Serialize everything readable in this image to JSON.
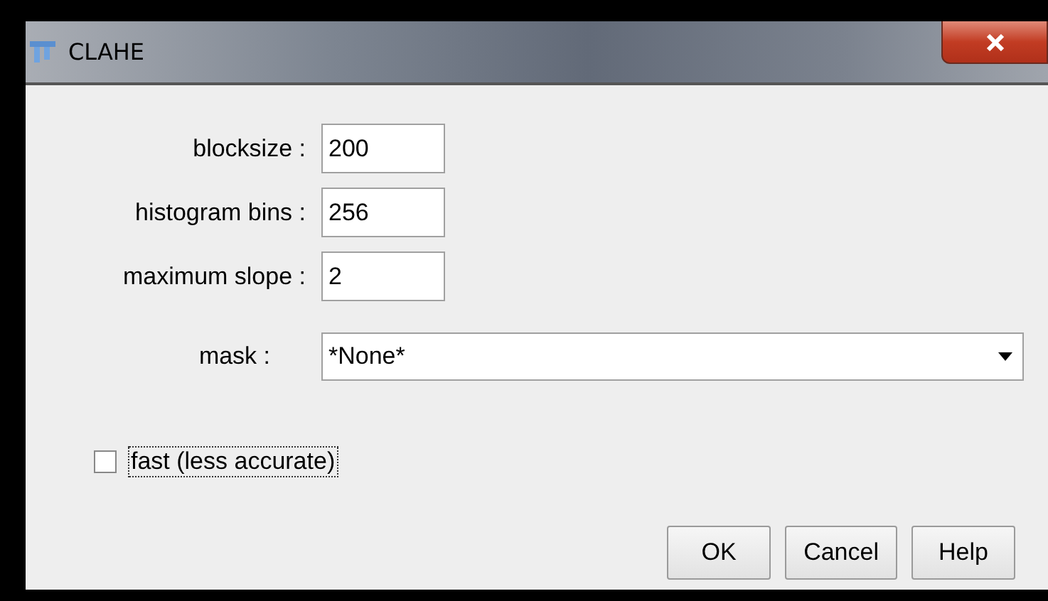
{
  "window": {
    "title": "CLAHE"
  },
  "fields": [
    {
      "label": "blocksize :",
      "value": "200"
    },
    {
      "label": "histogram bins :",
      "value": "256"
    },
    {
      "label": "maximum slope :",
      "value": "2"
    }
  ],
  "mask": {
    "label": "mask :",
    "value": "*None*"
  },
  "options": [
    {
      "label": "fast (less accurate)",
      "checked": false,
      "focused": true
    }
  ],
  "buttons": [
    "OK",
    "Cancel",
    "Help"
  ]
}
